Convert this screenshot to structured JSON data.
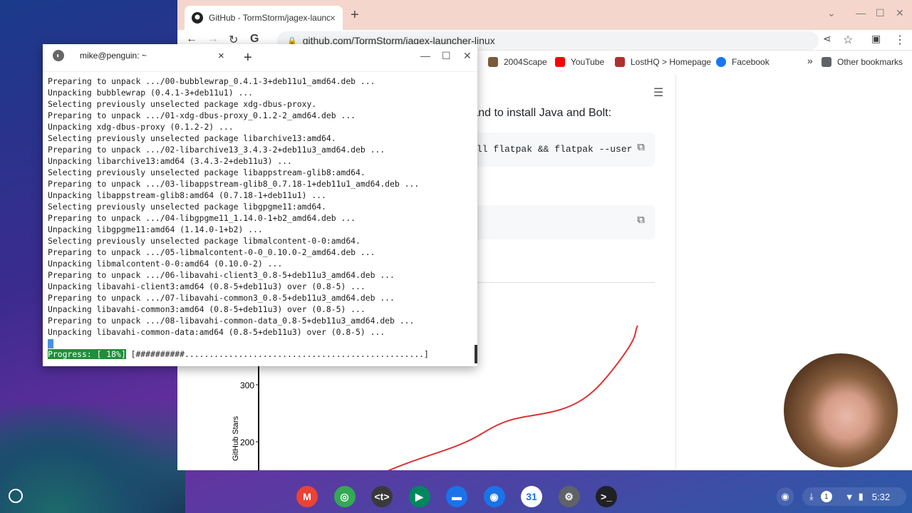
{
  "chrome": {
    "tab_title": "GitHub - TormStorm/jagex-launc",
    "tab_close": "×",
    "new_tab": "+",
    "url": "github.com/TormStorm/jagex-launcher-linux",
    "bookmarks": [
      {
        "label": "2004Scape",
        "icon": "sword-icon"
      },
      {
        "label": "YouTube",
        "icon": "youtube-icon"
      },
      {
        "label": "LostHQ > Homepage",
        "icon": "sword-icon"
      },
      {
        "label": "Facebook",
        "icon": "facebook-icon"
      }
    ],
    "bookmarks_overflow": "»",
    "other_bookmarks": "Other bookmarks"
  },
  "page": {
    "instruction_text": "mand to install Java and Bolt:",
    "code_line_1": "ll flatpak && flatpak --user",
    "chart_tick_300": "300",
    "chart_tick_200": "200",
    "chart_ylabel": "GitHub Stars"
  },
  "terminal": {
    "title": "mike@penguin: ~",
    "avatar": "◐",
    "close": "×",
    "add": "+",
    "lines": [
      "Preparing to unpack .../00-bubblewrap_0.4.1-3+deb11u1_amd64.deb ...",
      "Unpacking bubblewrap (0.4.1-3+deb11u1) ...",
      "Selecting previously unselected package xdg-dbus-proxy.",
      "Preparing to unpack .../01-xdg-dbus-proxy_0.1.2-2_amd64.deb ...",
      "Unpacking xdg-dbus-proxy (0.1.2-2) ...",
      "Selecting previously unselected package libarchive13:amd64.",
      "Preparing to unpack .../02-libarchive13_3.4.3-2+deb11u3_amd64.deb ...",
      "Unpacking libarchive13:amd64 (3.4.3-2+deb11u3) ...",
      "Selecting previously unselected package libappstream-glib8:amd64.",
      "Preparing to unpack .../03-libappstream-glib8_0.7.18-1+deb11u1_amd64.deb ...",
      "Unpacking libappstream-glib8:amd64 (0.7.18-1+deb11u1) ...",
      "Selecting previously unselected package libgpgme11:amd64.",
      "Preparing to unpack .../04-libgpgme11_1.14.0-1+b2_amd64.deb ...",
      "Unpacking libgpgme11:amd64 (1.14.0-1+b2) ...",
      "Selecting previously unselected package libmalcontent-0-0:amd64.",
      "Preparing to unpack .../05-libmalcontent-0-0_0.10.0-2_amd64.deb ...",
      "Unpacking libmalcontent-0-0:amd64 (0.10.0-2) ...",
      "Preparing to unpack .../06-libavahi-client3_0.8-5+deb11u3_amd64.deb ...",
      "Unpacking libavahi-client3:amd64 (0.8-5+deb11u3) over (0.8-5) ...",
      "Preparing to unpack .../07-libavahi-common3_0.8-5+deb11u3_amd64.deb ...",
      "Unpacking libavahi-common3:amd64 (0.8-5+deb11u3) over (0.8-5) ...",
      "Preparing to unpack .../08-libavahi-common-data_0.8-5+deb11u3_amd64.deb ...",
      "Unpacking libavahi-common-data:amd64 (0.8-5+deb11u3) over (0.8-5) ..."
    ],
    "progress_label": "Progress: [ 18%]",
    "progress_bar": " [##########.................................................] "
  },
  "shelf": {
    "apps": [
      {
        "name": "gmail-icon",
        "glyph": "M",
        "color": "#ea4335"
      },
      {
        "name": "chrome-icon",
        "glyph": "◎",
        "color": "#34a853"
      },
      {
        "name": "text-editor-icon",
        "glyph": "<t>",
        "color": "#3a3a3a"
      },
      {
        "name": "play-store-icon",
        "glyph": "▶",
        "color": "#01875f"
      },
      {
        "name": "files-icon",
        "glyph": "▬",
        "color": "#1a73e8"
      },
      {
        "name": "camera-icon",
        "glyph": "◉",
        "color": "#1a73e8"
      },
      {
        "name": "calendar-icon",
        "glyph": "31",
        "color": "#ffffff"
      },
      {
        "name": "settings-icon",
        "glyph": "⚙",
        "color": "#5f6368"
      },
      {
        "name": "terminal-icon",
        "glyph": ">_",
        "color": "#202124"
      }
    ],
    "notification_count": "1",
    "time": "5:32"
  }
}
